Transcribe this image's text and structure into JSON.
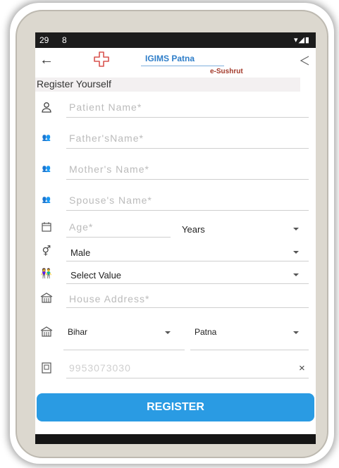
{
  "status": {
    "time": "29",
    "sim": "8",
    "icons": "▾◢▮"
  },
  "header": {
    "app_name": "IGIMS Patna",
    "sub_name": "e-Sushrut"
  },
  "page_title": "Register Yourself",
  "fields": {
    "patient_name": "Patient Name*",
    "father_name": "Father'sName*",
    "mother_name": "Mother's Name*",
    "spouse_name": "Spouse's Name*",
    "age": "Age*",
    "age_unit": "Years",
    "gender": "Male",
    "relation": "Select Value",
    "address": "House Address*",
    "state": "Bihar",
    "district": "Patna",
    "mobile": "9953073030",
    "clear": "×"
  },
  "register_label": "REGISTER",
  "colors": {
    "accent": "#2a9be3",
    "title": "#2e7ec9",
    "subtitle": "#a33a2b"
  }
}
